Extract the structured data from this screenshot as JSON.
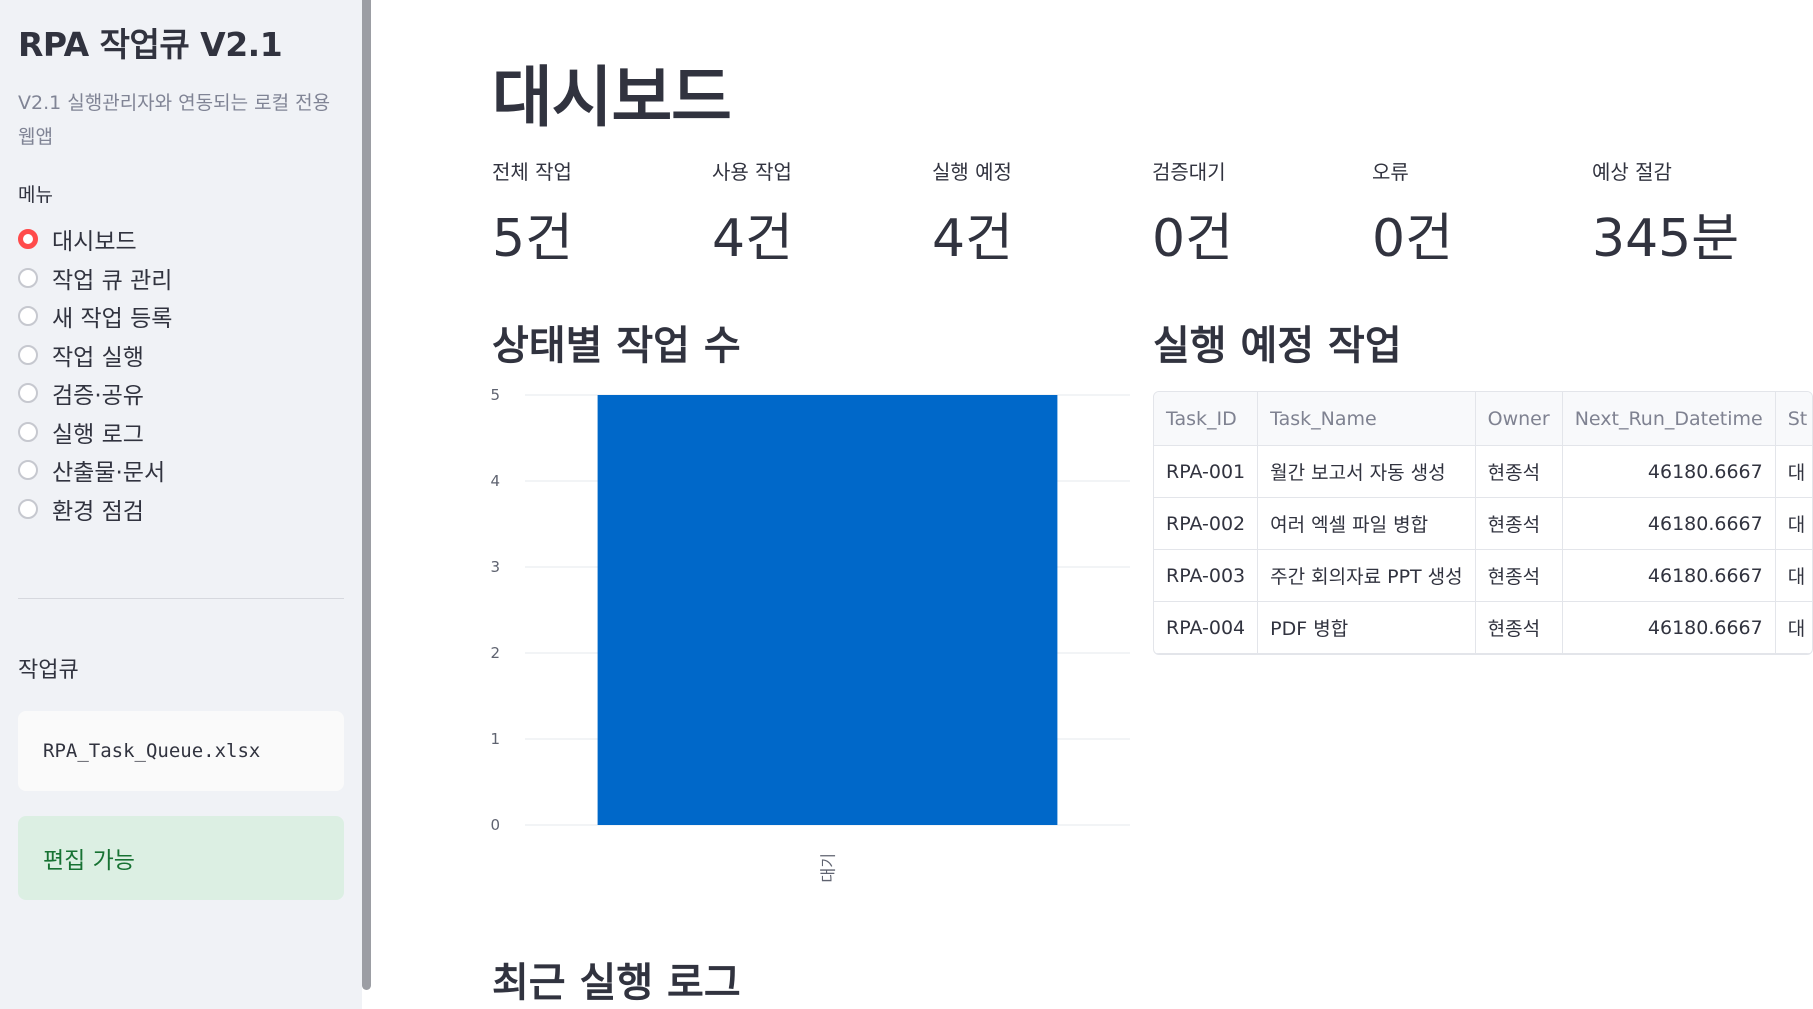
{
  "sidebar": {
    "app_title": "RPA 작업큐 V2.1",
    "description": "V2.1 실행관리자와 연동되는 로컬 전용 웹앱",
    "menu_label": "메뉴",
    "menu_items": [
      {
        "label": "대시보드",
        "selected": true
      },
      {
        "label": "작업 큐 관리",
        "selected": false
      },
      {
        "label": "새 작업 등록",
        "selected": false
      },
      {
        "label": "작업 실행",
        "selected": false
      },
      {
        "label": "검증·공유",
        "selected": false
      },
      {
        "label": "실행 로그",
        "selected": false
      },
      {
        "label": "산출물·문서",
        "selected": false
      },
      {
        "label": "환경 점검",
        "selected": false
      }
    ],
    "queue_label": "작업큐",
    "queue_file": "RPA_Task_Queue.xlsx",
    "edit_status": "편집 가능"
  },
  "main": {
    "title": "대시보드",
    "metrics": [
      {
        "label": "전체 작업",
        "value": "5건"
      },
      {
        "label": "사용 작업",
        "value": "4건"
      },
      {
        "label": "실행 예정",
        "value": "4건"
      },
      {
        "label": "검증대기",
        "value": "0건"
      },
      {
        "label": "오류",
        "value": "0건"
      },
      {
        "label": "예상 절감",
        "value": "345분"
      }
    ],
    "status_chart_title": "상태별 작업 수",
    "scheduled_title": "실행 예정 작업",
    "recent_log_title": "최근 실행 로그",
    "table": {
      "columns": [
        "Task_ID",
        "Task_Name",
        "Owner",
        "Next_Run_Datetime",
        "St"
      ],
      "rows": [
        [
          "RPA-001",
          "월간 보고서 자동 생성",
          "현종석",
          "46180.6667",
          "대"
        ],
        [
          "RPA-002",
          "여러 엑셀 파일 병합",
          "현종석",
          "46180.6667",
          "대"
        ],
        [
          "RPA-003",
          "주간 회의자료 PPT 생성",
          "현종석",
          "46180.6667",
          "대"
        ],
        [
          "RPA-004",
          "PDF 병합",
          "현종석",
          "46180.6667",
          "대"
        ]
      ]
    }
  },
  "chart_data": {
    "type": "bar",
    "categories": [
      "대기"
    ],
    "values": [
      5
    ],
    "ylim": [
      0,
      5
    ],
    "yticks": [
      "0",
      "1",
      "2",
      "3",
      "4",
      "5"
    ],
    "grid": true,
    "bar_color": "#0068c9"
  },
  "colors": {
    "accent": "#ff4b4b",
    "success_bg": "#dcefe3",
    "success_text": "#177233"
  }
}
